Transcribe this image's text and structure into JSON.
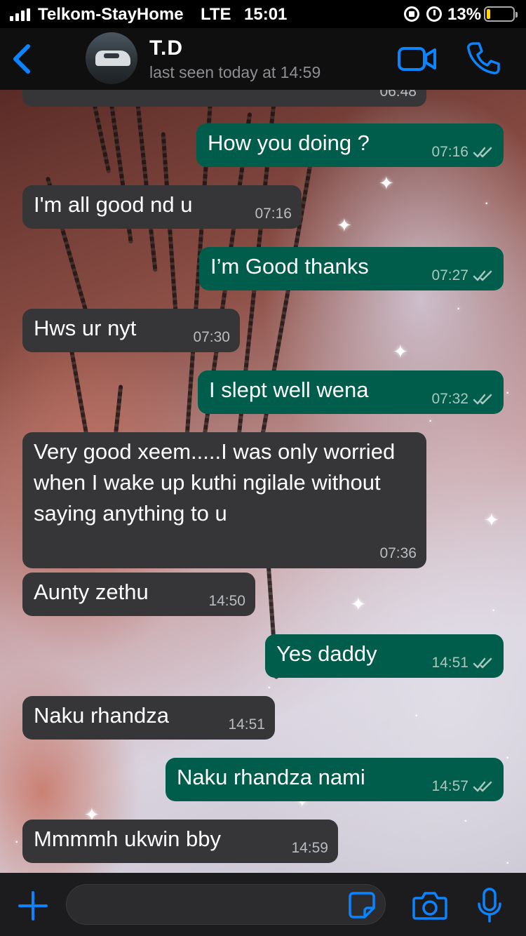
{
  "status_bar": {
    "carrier": "Telkom-StayHome",
    "network": "LTE",
    "time": "15:01",
    "battery_percent_label": "13%",
    "battery_level": 0.13
  },
  "header": {
    "contact_name": "T.D",
    "last_seen": "last seen today at 14:59",
    "icons": {
      "back": "chevron-left-icon",
      "video": "video-camera-icon",
      "call": "phone-icon"
    }
  },
  "messages": [
    {
      "direction": "in",
      "text": "",
      "time": "06:48"
    },
    {
      "direction": "out",
      "text": "How you doing ?",
      "time": "07:16"
    },
    {
      "direction": "in",
      "text": "I'm all good nd u",
      "time": "07:16"
    },
    {
      "direction": "out",
      "text": "I’m Good thanks",
      "time": "07:27"
    },
    {
      "direction": "in",
      "text": "Hws ur nyt",
      "time": "07:30"
    },
    {
      "direction": "out",
      "text": "I slept well wena",
      "time": "07:32"
    },
    {
      "direction": "in",
      "text": "Very good xeem.....I was only worried when I wake up kuthi ngilale without saying anything to u",
      "time": "07:36"
    },
    {
      "direction": "in",
      "text": "Aunty zethu",
      "time": "14:50"
    },
    {
      "direction": "out",
      "text": "Yes daddy",
      "time": "14:51"
    },
    {
      "direction": "in",
      "text": "Naku rhandza",
      "time": "14:51"
    },
    {
      "direction": "out",
      "text": "Naku rhandza nami",
      "time": "14:57"
    },
    {
      "direction": "in",
      "text": "Mmmmh ukwin bby",
      "time": "14:59"
    }
  ],
  "composer": {
    "input_value": "",
    "icons": {
      "add": "plus-icon",
      "sticker": "sticker-icon",
      "camera": "camera-icon",
      "mic": "microphone-icon"
    }
  },
  "colors": {
    "incoming_bubble": "#363638",
    "outgoing_bubble": "#005c4b",
    "accent": "#0a84ff",
    "battery": "#ffd60a"
  }
}
